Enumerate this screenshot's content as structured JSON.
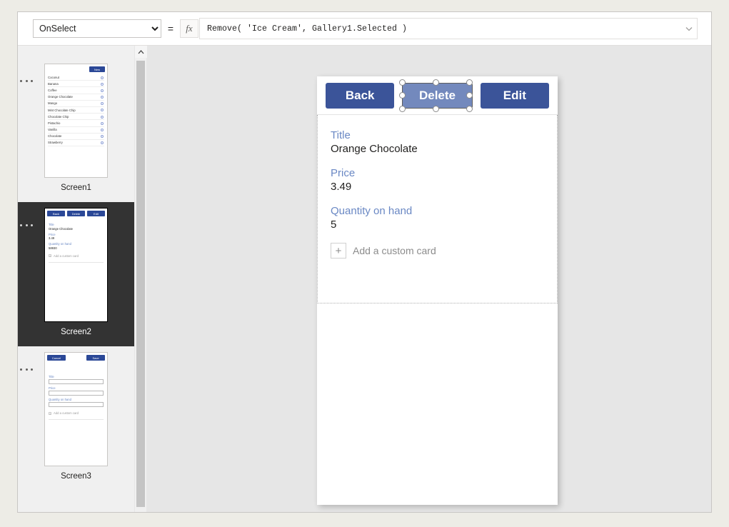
{
  "formula_bar": {
    "property_selected": "OnSelect",
    "property_options": [
      "OnSelect"
    ],
    "equals": "=",
    "fx_label": "fx",
    "formula_value": "Remove( 'Ice Cream', Gallery1.Selected )",
    "expand_icon": "chevron-down-icon"
  },
  "screens": [
    {
      "name": "Screen1",
      "selected": false,
      "type": "gallery",
      "new_button": "New",
      "items": [
        "Coconut",
        "Banana",
        "Coffee",
        "Orange Chocolate",
        "Mango",
        "Mint Chocolate Chip",
        "Chocolate Chip",
        "Pistachio",
        "Vanilla",
        "Chocolate",
        "Strawberry"
      ]
    },
    {
      "name": "Screen2",
      "selected": true,
      "type": "detail",
      "buttons": [
        "Back",
        "Delete",
        "Edit"
      ],
      "fields": [
        {
          "label": "Title",
          "value": "Orange Chocolate"
        },
        {
          "label": "Price",
          "value": "3.49"
        },
        {
          "label": "Quantity on hand",
          "value": "58930"
        }
      ],
      "add_card": "Add a custom card"
    },
    {
      "name": "Screen3",
      "selected": false,
      "type": "edit",
      "buttons": [
        "Cancel",
        "Save"
      ],
      "fields": [
        {
          "label": "Title",
          "value": ""
        },
        {
          "label": "Price",
          "value": ""
        },
        {
          "label": "Quantity on hand",
          "value": ""
        }
      ],
      "add_card": "Add a custom card"
    }
  ],
  "canvas": {
    "buttons": [
      {
        "label": "Back",
        "selected": false
      },
      {
        "label": "Delete",
        "selected": true
      },
      {
        "label": "Edit",
        "selected": false
      }
    ],
    "fields": [
      {
        "label": "Title",
        "value": "Orange Chocolate"
      },
      {
        "label": "Price",
        "value": "3.49"
      },
      {
        "label": "Quantity on hand",
        "value": "5"
      }
    ],
    "add_custom_card": "Add a custom card",
    "plus_icon": "+"
  },
  "scrollbar": {
    "up_arrow": "scroll-up-icon"
  },
  "colors": {
    "button_blue": "#3b5499",
    "button_selected_blue": "#7389bd",
    "label_blue": "#6a88c4",
    "thumb_button_blue": "#2b4897",
    "selected_rail_bg": "#333333",
    "page_bg": "#edece6",
    "canvas_bg": "#e6e6e6"
  }
}
